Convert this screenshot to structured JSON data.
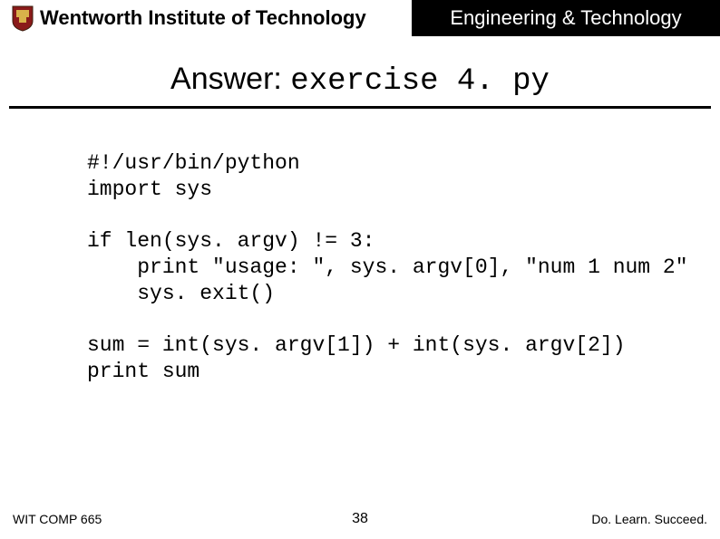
{
  "header": {
    "institution": "Wentworth Institute of Technology",
    "department": "Engineering & Technology"
  },
  "title": {
    "prefix": "Answer: ",
    "filename": "exercise 4. py"
  },
  "code": "#!/usr/bin/python\nimport sys\n\nif len(sys. argv) != 3:\n    print \"usage: \", sys. argv[0], \"num 1 num 2\"\n    sys. exit()\n\nsum = int(sys. argv[1]) + int(sys. argv[2])\nprint sum",
  "footer": {
    "course": "WIT COMP 665",
    "page": "38",
    "motto": "Do. Learn. Succeed."
  }
}
